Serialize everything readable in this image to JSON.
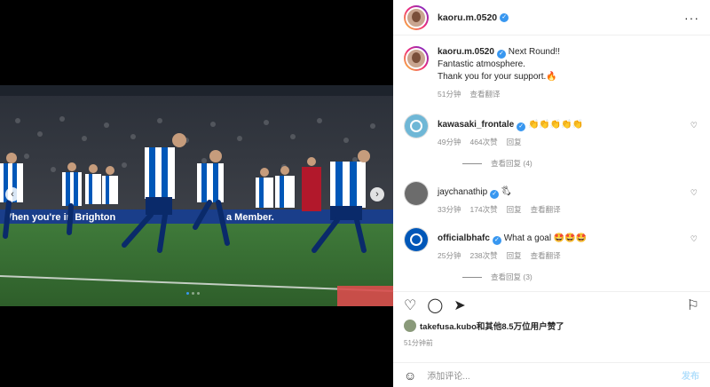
{
  "post": {
    "author": "kaoru.m.0520",
    "caption_line1": "Next Round!!",
    "caption_line2": "Fantastic atmosphere.",
    "caption_line3": "Thank you for your support.",
    "caption_emoji": "🔥",
    "caption_time": "51分钟",
    "caption_translate": "查看翻译",
    "photo_banner_text": "Vhen you're in Brighton",
    "photo_banner_text2": "a Member."
  },
  "comments": [
    {
      "user": "kawasaki_frontale",
      "text": "👏👏👏👏👏",
      "time": "49分钟",
      "likes": "464次赞",
      "reply": "回复",
      "view_replies": "查看回复 (4)"
    },
    {
      "user": "jaychanathip",
      "text": "🖏",
      "time": "33分钟",
      "likes": "174次赞",
      "reply": "回复",
      "translate": "查看翻译"
    },
    {
      "user": "officialbhafc",
      "text": "What a goal 🤩🤩🤩",
      "time": "25分钟",
      "likes": "238次赞",
      "reply": "回复",
      "translate": "查看翻译",
      "view_replies": "查看回复 (3)"
    }
  ],
  "likes_line": "takefusa.kubo和其他8.5万位用户赞了",
  "post_time": "51分钟前",
  "add_comment_placeholder": "添加评论...",
  "post_button": "发布",
  "colors": {
    "accent": "#3897f0",
    "muted": "#8e8e8e",
    "post_disabled": "#b2dffc"
  }
}
